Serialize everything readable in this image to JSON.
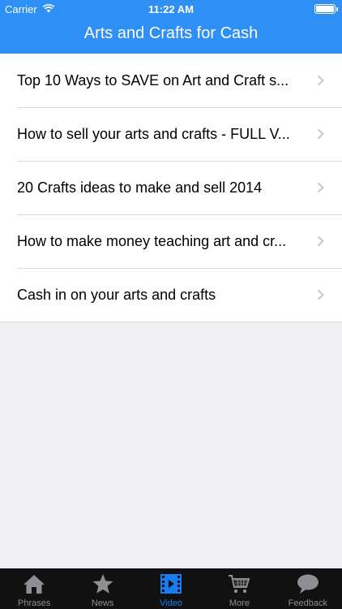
{
  "status_bar": {
    "carrier": "Carrier",
    "time": "11:22 AM"
  },
  "header": {
    "title": "Arts and Crafts for Cash"
  },
  "list": {
    "items": [
      {
        "label": "Top 10 Ways to SAVE on Art and Craft s..."
      },
      {
        "label": "How to sell your arts and crafts - FULL V..."
      },
      {
        "label": "20 Crafts ideas to make and sell 2014"
      },
      {
        "label": "How to make money teaching art and cr..."
      },
      {
        "label": "Cash in on your arts and crafts"
      }
    ]
  },
  "tabbar": {
    "active": "Video",
    "tabs": [
      {
        "label": "Phrases",
        "icon": "house-icon"
      },
      {
        "label": "News",
        "icon": "star-icon"
      },
      {
        "label": "Video",
        "icon": "film-icon"
      },
      {
        "label": "More",
        "icon": "cart-icon"
      },
      {
        "label": "Feedback",
        "icon": "speech-bubble-icon"
      }
    ]
  },
  "colors": {
    "accent": "#2e8ff5",
    "active_tab": "#1a7cf2",
    "tabbar_bg": "#111111"
  }
}
